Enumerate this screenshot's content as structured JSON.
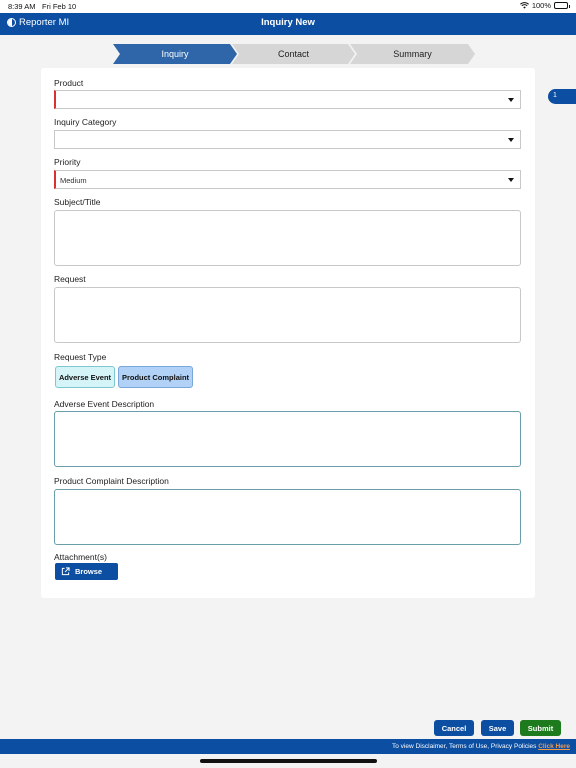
{
  "status_bar": {
    "time": "8:39 AM",
    "date": "Fri Feb 10",
    "battery": "100%",
    "icons": [
      "wifi-icon",
      "battery-icon"
    ]
  },
  "header": {
    "brand": "Reporter MI",
    "title": "Inquiry New"
  },
  "steps": [
    {
      "label": "Inquiry",
      "active": true
    },
    {
      "label": "Contact",
      "active": false
    },
    {
      "label": "Summary",
      "active": false
    }
  ],
  "side_tab": {
    "label": "1"
  },
  "form": {
    "product": {
      "label": "Product",
      "value": ""
    },
    "inquiry_category": {
      "label": "Inquiry Category",
      "value": ""
    },
    "priority": {
      "label": "Priority",
      "value": "Medium"
    },
    "subject": {
      "label": "Subject/Title",
      "value": ""
    },
    "request": {
      "label": "Request",
      "value": ""
    },
    "request_type": {
      "label": "Request Type",
      "options": [
        "Adverse Event",
        "Product Complaint"
      ]
    },
    "adverse_event_description": {
      "label": "Adverse Event Description",
      "value": ""
    },
    "product_complaint_description": {
      "label": "Product Complaint Description",
      "value": ""
    },
    "attachments": {
      "label": "Attachment(s)",
      "browse_label": "Browse"
    }
  },
  "actions": {
    "cancel": "Cancel",
    "save": "Save",
    "submit": "Submit"
  },
  "footer": {
    "text": "To view Disclaimer, Terms of Use, Privacy Policies",
    "link": "Click Here"
  },
  "colors": {
    "primary": "#0b4ea2",
    "submit": "#1d7a1d",
    "required": "#d93030",
    "active_step": "#2f66a9"
  }
}
